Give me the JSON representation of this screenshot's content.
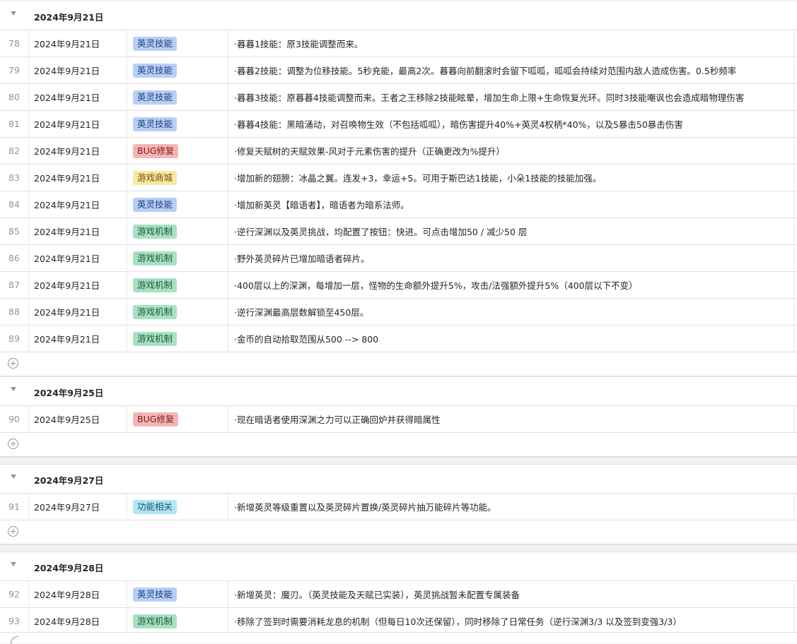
{
  "groups": [
    {
      "title": "2024年9月21日",
      "rows": [
        {
          "idx": "78",
          "date": "2024年9月21日",
          "tag": "英灵技能",
          "tag_type": "skill",
          "desc": "·暮暮1技能：原3技能调整而来。"
        },
        {
          "idx": "79",
          "date": "2024年9月21日",
          "tag": "英灵技能",
          "tag_type": "skill",
          "desc": "·暮暮2技能：调整为位移技能。5秒充能，最高2次。暮暮向前翻滚时会留下呱呱，呱呱会持续对范围内敌人造成伤害。0.5秒频率"
        },
        {
          "idx": "80",
          "date": "2024年9月21日",
          "tag": "英灵技能",
          "tag_type": "skill",
          "desc": "·暮暮3技能：原暮暮4技能调整而来。王者之王移除2技能眩晕，增加生命上限+生命恢复光环。同时3技能嘲讽也会造成暗物理伤害"
        },
        {
          "idx": "81",
          "date": "2024年9月21日",
          "tag": "英灵技能",
          "tag_type": "skill",
          "desc": "·暮暮4技能：黑暗涌动，对召唤物生效（不包括呱呱），暗伤害提升40%+英灵4权柄*40%，以及5暴击50暴击伤害"
        },
        {
          "idx": "82",
          "date": "2024年9月21日",
          "tag": "BUG修复",
          "tag_type": "bug",
          "desc": "·修复天赋树的天赋效果-风对于元素伤害的提升（正确更改为%提升）"
        },
        {
          "idx": "83",
          "date": "2024年9月21日",
          "tag": "游戏商城",
          "tag_type": "shop",
          "desc": "·增加新的翅膀：冰晶之翼。连发+3，幸运+5。可用于斯巴达1技能，小朵1技能的技能加强。"
        },
        {
          "idx": "84",
          "date": "2024年9月21日",
          "tag": "英灵技能",
          "tag_type": "skill",
          "desc": "·增加新英灵【暗语者】，暗语者为暗系法师。"
        },
        {
          "idx": "85",
          "date": "2024年9月21日",
          "tag": "游戏机制",
          "tag_type": "mech",
          "desc": "·逆行深渊以及英灵挑战，均配置了按钮：快进。可点击增加50 / 减少50 层"
        },
        {
          "idx": "86",
          "date": "2024年9月21日",
          "tag": "游戏机制",
          "tag_type": "mech",
          "desc": "·野外英灵碎片已增加暗语者碎片。"
        },
        {
          "idx": "87",
          "date": "2024年9月21日",
          "tag": "游戏机制",
          "tag_type": "mech",
          "desc": "·400层以上的深渊，每增加一层，怪物的生命额外提升5%，攻击/法强额外提升5%（400层以下不变）"
        },
        {
          "idx": "88",
          "date": "2024年9月21日",
          "tag": "游戏机制",
          "tag_type": "mech",
          "desc": "·逆行深渊最高层数解锁至450层。"
        },
        {
          "idx": "89",
          "date": "2024年9月21日",
          "tag": "游戏机制",
          "tag_type": "mech",
          "desc": "·金币的自动拾取范围从500 --> 800"
        }
      ]
    },
    {
      "title": "2024年9月25日",
      "rows": [
        {
          "idx": "90",
          "date": "2024年9月25日",
          "tag": "BUG修复",
          "tag_type": "bug",
          "desc": "·现在暗语者使用深渊之力可以正确回炉并获得暗属性"
        }
      ]
    },
    {
      "title": "2024年9月27日",
      "rows": [
        {
          "idx": "91",
          "date": "2024年9月27日",
          "tag": "功能相关",
          "tag_type": "func",
          "desc": "·新增英灵等级重置以及英灵碎片置换/英灵碎片抽万能碎片等功能。"
        }
      ]
    },
    {
      "title": "2024年9月28日",
      "rows": [
        {
          "idx": "92",
          "date": "2024年9月28日",
          "tag": "英灵技能",
          "tag_type": "skill",
          "desc": "·新增英灵：魔刃。（英灵技能及天赋已实装），英灵挑战暂未配置专属装备"
        },
        {
          "idx": "93",
          "date": "2024年9月28日",
          "tag": "游戏机制",
          "tag_type": "mech",
          "desc": "·移除了签到时需要消耗龙息的机制（但每日10次还保留），同时移除了日常任务（逆行深渊3/3 以及签到变强3/3）"
        }
      ]
    }
  ],
  "icons": {
    "collapse": "caret-down-icon",
    "add": "plus-circle-icon"
  }
}
